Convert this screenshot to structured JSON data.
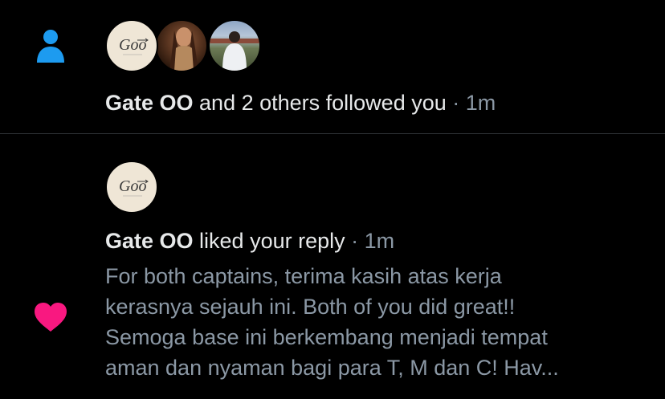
{
  "colors": {
    "background": "#000000",
    "follow_icon": "#1d9bf0",
    "like_icon": "#f91880",
    "primary_text": "#e7e9ea",
    "secondary_text": "#8b98a5",
    "divider": "#2f3336"
  },
  "notifications": [
    {
      "type": "follow",
      "icon": "person-icon",
      "avatars": [
        "gate-oo-logo",
        "woman-photo",
        "man-photo"
      ],
      "name": "Gate OO",
      "action": " and 2 others followed you",
      "time": " · 1m"
    },
    {
      "type": "like",
      "icon": "heart-icon",
      "avatars": [
        "gate-oo-logo"
      ],
      "name": "Gate OO",
      "action": " liked your reply",
      "time": " · 1m",
      "reply_text": "For both captains, terima kasih atas kerja\nkerasnya sejauh ini. Both of you did great!!\nSemoga base ini berkembang menjadi tempat\naman dan nyaman bagi para T, M dan C! Hav..."
    }
  ]
}
